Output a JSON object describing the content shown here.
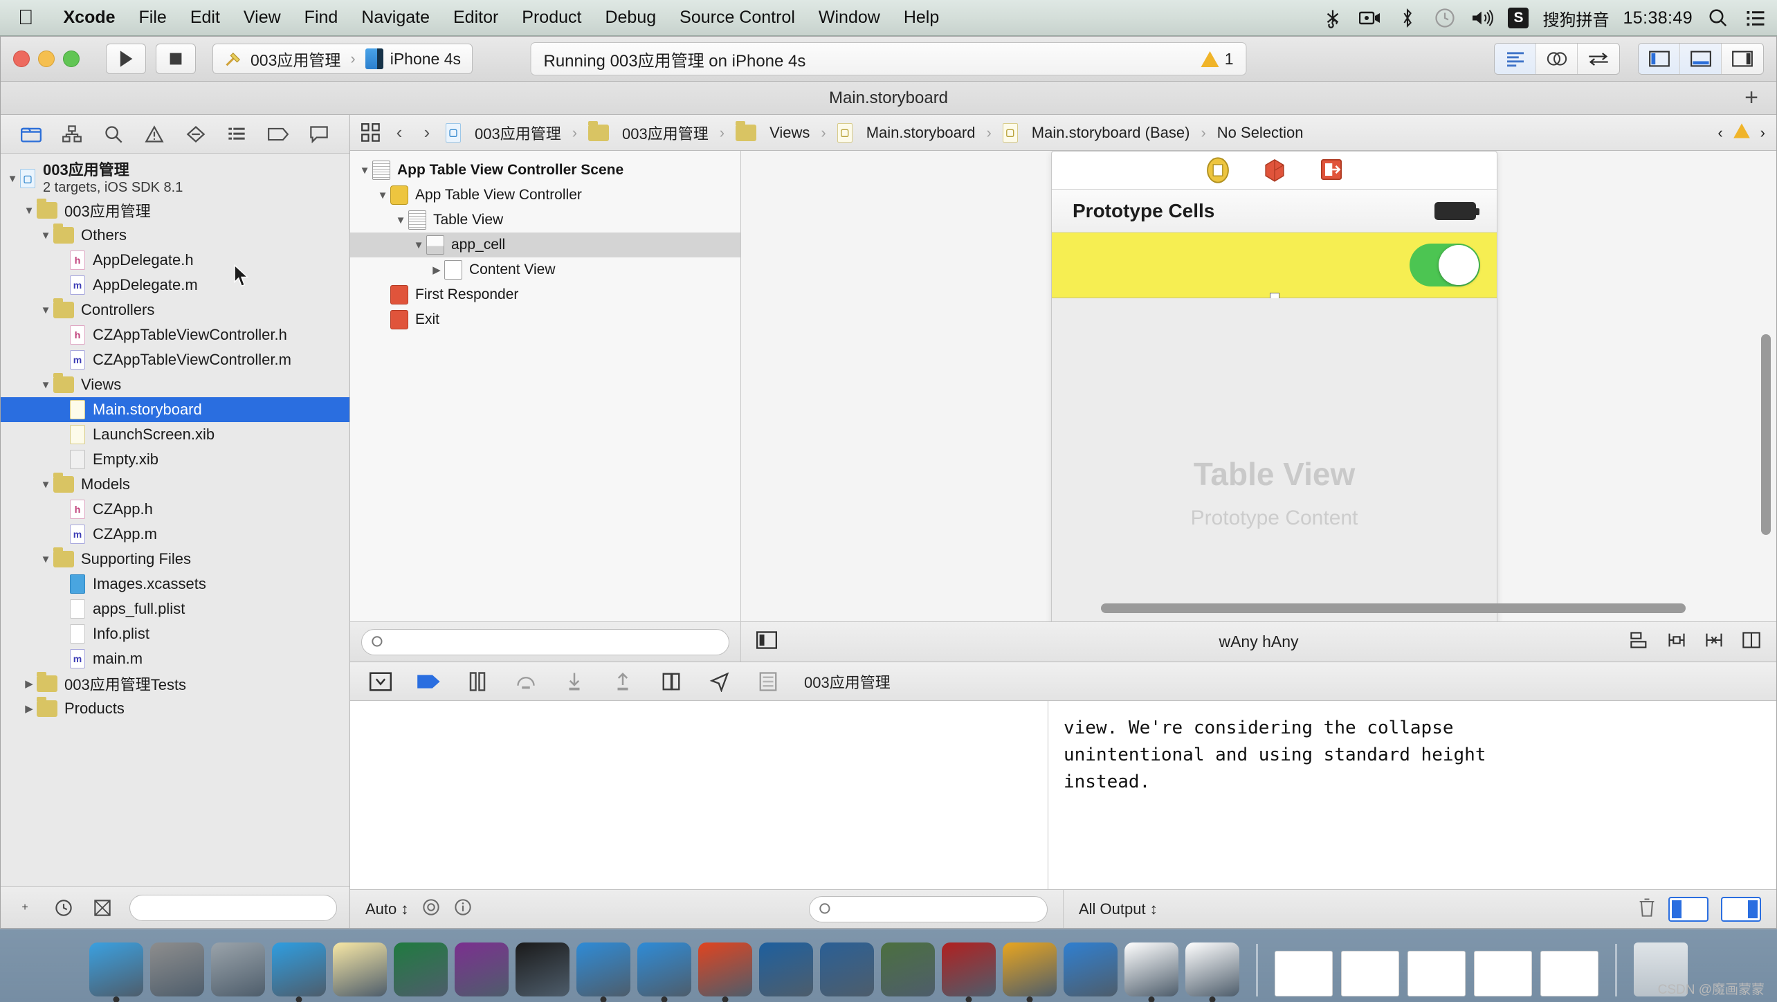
{
  "menubar": {
    "apple_glyph": "",
    "items": [
      {
        "label": "Xcode",
        "bold": true
      },
      {
        "label": "File",
        "bold": false
      },
      {
        "label": "Edit",
        "bold": false
      },
      {
        "label": "View",
        "bold": false
      },
      {
        "label": "Find",
        "bold": false
      },
      {
        "label": "Navigate",
        "bold": false
      },
      {
        "label": "Editor",
        "bold": false
      },
      {
        "label": "Product",
        "bold": false
      },
      {
        "label": "Debug",
        "bold": false
      },
      {
        "label": "Source Control",
        "bold": false
      },
      {
        "label": "Window",
        "bold": false
      },
      {
        "label": "Help",
        "bold": false
      }
    ],
    "status_items": [
      "scissors-icon",
      "screen-record-icon",
      "bluetooth-icon",
      "time-machine-icon",
      "volume-icon"
    ],
    "input_method_badge": "S",
    "input_method_label": "搜狗拼音",
    "clock": "15:38:49",
    "spotlight_icon": "search-icon",
    "notification_icon": "notification-center-icon"
  },
  "toolbar": {
    "run_label": "Run",
    "stop_label": "Stop",
    "scheme_name": "003应用管理",
    "scheme_separator": "›",
    "destination": "iPhone 4s",
    "activity_status": "Running 003应用管理 on iPhone 4s",
    "warning_count": "1",
    "editor_buttons": [
      "standard-editor-icon",
      "assistant-editor-icon",
      "version-editor-icon"
    ],
    "view_buttons": [
      "toggle-navigator-icon",
      "toggle-debug-area-icon",
      "toggle-utilities-icon"
    ]
  },
  "window": {
    "title": "Main.storyboard",
    "add_button": "+"
  },
  "navigator": {
    "tabs": [
      "project-navigator-icon",
      "symbol-navigator-icon",
      "search-navigator-icon",
      "issue-navigator-icon",
      "test-navigator-icon",
      "debug-navigator-icon",
      "breakpoint-navigator-icon",
      "report-navigator-icon"
    ],
    "project": {
      "name": "003应用管理",
      "subtitle": "2 targets, iOS SDK 8.1"
    },
    "tree": [
      {
        "label": "003应用管理",
        "kind": "folder",
        "depth": 1,
        "disclosure": "open",
        "selected": false
      },
      {
        "label": "Others",
        "kind": "folder",
        "depth": 2,
        "disclosure": "open",
        "selected": false
      },
      {
        "label": "AppDelegate.h",
        "kind": "h",
        "depth": 3,
        "disclosure": "none",
        "selected": false
      },
      {
        "label": "AppDelegate.m",
        "kind": "m",
        "depth": 3,
        "disclosure": "none",
        "selected": false
      },
      {
        "label": "Controllers",
        "kind": "folder",
        "depth": 2,
        "disclosure": "open",
        "selected": false
      },
      {
        "label": "CZAppTableViewController.h",
        "kind": "h",
        "depth": 3,
        "disclosure": "none",
        "selected": false
      },
      {
        "label": "CZAppTableViewController.m",
        "kind": "m",
        "depth": 3,
        "disclosure": "none",
        "selected": false
      },
      {
        "label": "Views",
        "kind": "folder",
        "depth": 2,
        "disclosure": "open",
        "selected": false
      },
      {
        "label": "Main.storyboard",
        "kind": "sb",
        "depth": 3,
        "disclosure": "none",
        "selected": true
      },
      {
        "label": "LaunchScreen.xib",
        "kind": "xib",
        "depth": 3,
        "disclosure": "none",
        "selected": false
      },
      {
        "label": "Empty.xib",
        "kind": "grey",
        "depth": 3,
        "disclosure": "none",
        "selected": false
      },
      {
        "label": "Models",
        "kind": "folder",
        "depth": 2,
        "disclosure": "open",
        "selected": false
      },
      {
        "label": "CZApp.h",
        "kind": "h",
        "depth": 3,
        "disclosure": "none",
        "selected": false
      },
      {
        "label": "CZApp.m",
        "kind": "m",
        "depth": 3,
        "disclosure": "none",
        "selected": false
      },
      {
        "label": "Supporting Files",
        "kind": "folder",
        "depth": 2,
        "disclosure": "open",
        "selected": false
      },
      {
        "label": "Images.xcassets",
        "kind": "xcassets",
        "depth": 3,
        "disclosure": "none",
        "selected": false
      },
      {
        "label": "apps_full.plist",
        "kind": "plist",
        "depth": 3,
        "disclosure": "none",
        "selected": false
      },
      {
        "label": "Info.plist",
        "kind": "plist",
        "depth": 3,
        "disclosure": "none",
        "selected": false
      },
      {
        "label": "main.m",
        "kind": "m",
        "depth": 3,
        "disclosure": "none",
        "selected": false
      },
      {
        "label": "003应用管理Tests",
        "kind": "folder",
        "depth": 1,
        "disclosure": "closed",
        "selected": false
      },
      {
        "label": "Products",
        "kind": "folder",
        "depth": 1,
        "disclosure": "closed",
        "selected": false
      }
    ],
    "footer_icons": [
      "add-file-icon",
      "recent-filter-icon",
      "source-control-filter-icon"
    ],
    "filter_placeholder": ""
  },
  "jumpbar": {
    "related_icon": "related-items-icon",
    "back": "‹",
    "forward": "›",
    "crumbs": [
      {
        "label": "003应用管理",
        "kind": "proj"
      },
      {
        "label": "003应用管理",
        "kind": "folder"
      },
      {
        "label": "Views",
        "kind": "folder"
      },
      {
        "label": "Main.storyboard",
        "kind": "sb"
      },
      {
        "label": "Main.storyboard (Base)",
        "kind": "sb"
      },
      {
        "label": "No Selection",
        "kind": "none"
      }
    ],
    "right_icons": [
      "previous-issue-icon",
      "warning-icon",
      "next-issue-icon"
    ]
  },
  "outline": {
    "rows": [
      {
        "label": "App Table View Controller Scene",
        "depth": 0,
        "disclosure": "open",
        "icon": "scene-icon",
        "selected": false,
        "bold": true
      },
      {
        "label": "App Table View Controller",
        "depth": 1,
        "disclosure": "open",
        "icon": "view-controller-icon",
        "selected": false,
        "bold": false
      },
      {
        "label": "Table View",
        "depth": 2,
        "disclosure": "open",
        "icon": "table-view-icon",
        "selected": false,
        "bold": false
      },
      {
        "label": "app_cell",
        "depth": 3,
        "disclosure": "open",
        "icon": "table-view-cell-icon",
        "selected": true,
        "bold": false
      },
      {
        "label": "Content View",
        "depth": 4,
        "disclosure": "closed",
        "icon": "view-icon",
        "selected": false,
        "bold": false
      },
      {
        "label": "First Responder",
        "depth": 1,
        "disclosure": "none",
        "icon": "first-responder-icon",
        "selected": false,
        "bold": false
      },
      {
        "label": "Exit",
        "depth": 1,
        "disclosure": "none",
        "icon": "exit-icon",
        "selected": false,
        "bold": false
      }
    ],
    "filter_placeholder": ""
  },
  "canvas": {
    "scene_dock_icons": [
      "view-controller-icon",
      "first-responder-icon",
      "exit-icon"
    ],
    "table_header": "Prototype Cells",
    "placeholder_title": "Table View",
    "placeholder_subtitle": "Prototype Content",
    "switch_state": "on",
    "switch_color": "#4cc552",
    "cell_color": "#f6ee52",
    "size_class": "wAny hAny",
    "bottom_left_icon": "toggle-document-outline-icon",
    "bottom_right_icons": [
      "align-icon",
      "pin-icon",
      "resolve-auto-layout-icon",
      "resizing-behavior-icon"
    ]
  },
  "debug": {
    "bar_icons": [
      "hide-debug-area-icon",
      "continue-icon",
      "pause-icon",
      "step-over-icon",
      "step-into-icon",
      "step-out-icon",
      "simulate-location-icon",
      "view-debugging-icon",
      "memory-graph-icon"
    ],
    "process_label": "003应用管理",
    "console_lines": [
      "view. We're considering the collapse",
      "unintentional and using standard height",
      "instead."
    ],
    "variables_scope": "Auto",
    "variables_scope_icons": [
      "watch-icon",
      "info-icon"
    ],
    "variables_filter_placeholder": "",
    "output_scope": "All Output",
    "console_filter_placeholder": "",
    "trash_icon": "trash-icon",
    "pane_toggle_icons": [
      "show-variables-view-icon",
      "show-console-icon"
    ]
  },
  "dock": {
    "items": [
      {
        "name": "finder",
        "color": "#3aa0e0"
      },
      {
        "name": "system-preferences",
        "color": "#8d8d8d"
      },
      {
        "name": "launchpad",
        "color": "#9aa3aa"
      },
      {
        "name": "safari",
        "color": "#2e9de0"
      },
      {
        "name": "notes",
        "color": "#f7e7a5"
      },
      {
        "name": "excel",
        "color": "#1f7a3f"
      },
      {
        "name": "onenote",
        "color": "#7b2f8f"
      },
      {
        "name": "terminal",
        "color": "#1a1a1a"
      },
      {
        "name": "xcode-beta",
        "color": "#2e8bd6"
      },
      {
        "name": "ios-simulator",
        "color": "#2e8bd6"
      },
      {
        "name": "pdf-reader",
        "color": "#e0431f"
      },
      {
        "name": "snipping-tool",
        "color": "#1d5f9e"
      },
      {
        "name": "quicktime",
        "color": "#2a5f95"
      },
      {
        "name": "ftp-client",
        "color": "#4b6f3f"
      },
      {
        "name": "filezilla",
        "color": "#b02020"
      },
      {
        "name": "tux-app",
        "color": "#e8a51f"
      },
      {
        "name": "wps",
        "color": "#2f7fd0"
      },
      {
        "name": "xcode",
        "color": "#ffffff"
      },
      {
        "name": "xcode-2",
        "color": "#ffffff"
      }
    ],
    "minimized": [
      "window-1",
      "window-2",
      "window-3",
      "window-4",
      "window-5"
    ],
    "trash": "trash-icon"
  },
  "watermark": "CSDN @魔画蒙蒙"
}
